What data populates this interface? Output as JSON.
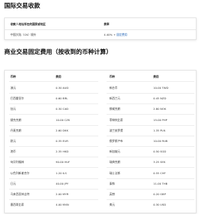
{
  "intl_section": {
    "title": "国际交易收款",
    "header": {
      "col1": "收款人地址所在的国家或地区",
      "col2": "费率"
    },
    "row": {
      "country": "中国大陆（CN）境外",
      "fee_text": "4.40% + ",
      "fee_link": "固定费用"
    }
  },
  "fixed_fee_section": {
    "title": "商业交易固定费用（按收到的币种计算）",
    "left_table": {
      "header": {
        "currency": "币种",
        "fee": "费用"
      },
      "rows": [
        {
          "currency": "澳元",
          "fee": "0.30 AUD"
        },
        {
          "currency": "巴西雷亚尔",
          "fee": "0.60 BRL"
        },
        {
          "currency": "加元",
          "fee": "0.30 CAD"
        },
        {
          "currency": "捷克克朗",
          "fee": "10.00 CZK"
        },
        {
          "currency": "丹麦克朗",
          "fee": "2.60 DKK"
        },
        {
          "currency": "欧元",
          "fee": "0.35 EUR"
        },
        {
          "currency": "港币",
          "fee": "2.35 HKD"
        },
        {
          "currency": "匈牙利福林",
          "fee": "90.00 HUF"
        },
        {
          "currency": "以色列新谢克尔",
          "fee": "1.20 ILS"
        },
        {
          "currency": "日元",
          "fee": "40.00 JPY"
        },
        {
          "currency": "马来西亚林吉特",
          "fee": "2.00 MYR"
        },
        {
          "currency": "墨西哥比索",
          "fee": "4.00 MXN"
        }
      ]
    },
    "right_table": {
      "header": {
        "currency": "币种",
        "fee": "费用"
      },
      "rows": [
        {
          "currency": "新台币",
          "fee": "10.00 TWD"
        },
        {
          "currency": "新西兰元",
          "fee": "0.45 NZD"
        },
        {
          "currency": "挪威克朗",
          "fee": "2.80 NOK"
        },
        {
          "currency": "菲律宾比索",
          "fee": "15.00 PHP"
        },
        {
          "currency": "波兰兹罗提",
          "fee": "1.35 PLN"
        },
        {
          "currency": "俄罗斯卢布",
          "fee": "10.00 RUB"
        },
        {
          "currency": "新加坡元",
          "fee": "0.50 SGD"
        },
        {
          "currency": "瑞典克朗",
          "fee": "3.25 SEK"
        },
        {
          "currency": "瑞士法郎",
          "fee": "0.55 CHF"
        },
        {
          "currency": "泰铢",
          "fee": "11.00 THB"
        },
        {
          "currency": "英镑",
          "fee": "0.20 GBP"
        },
        {
          "currency": "美元",
          "fee": "0.30 USD"
        }
      ]
    }
  }
}
